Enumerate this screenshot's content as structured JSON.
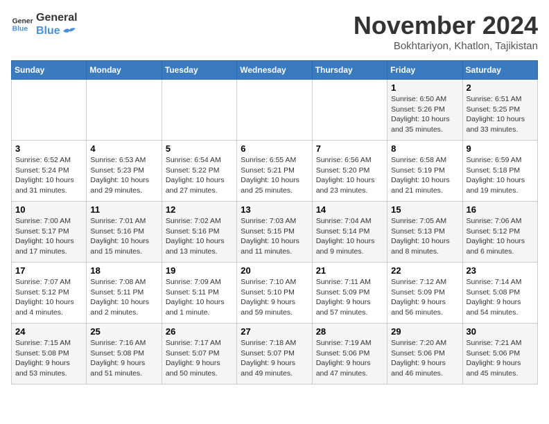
{
  "header": {
    "logo_line1": "General",
    "logo_line2": "Blue",
    "month": "November 2024",
    "location": "Bokhtariyon, Khatlon, Tajikistan"
  },
  "days_of_week": [
    "Sunday",
    "Monday",
    "Tuesday",
    "Wednesday",
    "Thursday",
    "Friday",
    "Saturday"
  ],
  "weeks": [
    [
      {
        "day": "",
        "info": ""
      },
      {
        "day": "",
        "info": ""
      },
      {
        "day": "",
        "info": ""
      },
      {
        "day": "",
        "info": ""
      },
      {
        "day": "",
        "info": ""
      },
      {
        "day": "1",
        "info": "Sunrise: 6:50 AM\nSunset: 5:26 PM\nDaylight: 10 hours\nand 35 minutes."
      },
      {
        "day": "2",
        "info": "Sunrise: 6:51 AM\nSunset: 5:25 PM\nDaylight: 10 hours\nand 33 minutes."
      }
    ],
    [
      {
        "day": "3",
        "info": "Sunrise: 6:52 AM\nSunset: 5:24 PM\nDaylight: 10 hours\nand 31 minutes."
      },
      {
        "day": "4",
        "info": "Sunrise: 6:53 AM\nSunset: 5:23 PM\nDaylight: 10 hours\nand 29 minutes."
      },
      {
        "day": "5",
        "info": "Sunrise: 6:54 AM\nSunset: 5:22 PM\nDaylight: 10 hours\nand 27 minutes."
      },
      {
        "day": "6",
        "info": "Sunrise: 6:55 AM\nSunset: 5:21 PM\nDaylight: 10 hours\nand 25 minutes."
      },
      {
        "day": "7",
        "info": "Sunrise: 6:56 AM\nSunset: 5:20 PM\nDaylight: 10 hours\nand 23 minutes."
      },
      {
        "day": "8",
        "info": "Sunrise: 6:58 AM\nSunset: 5:19 PM\nDaylight: 10 hours\nand 21 minutes."
      },
      {
        "day": "9",
        "info": "Sunrise: 6:59 AM\nSunset: 5:18 PM\nDaylight: 10 hours\nand 19 minutes."
      }
    ],
    [
      {
        "day": "10",
        "info": "Sunrise: 7:00 AM\nSunset: 5:17 PM\nDaylight: 10 hours\nand 17 minutes."
      },
      {
        "day": "11",
        "info": "Sunrise: 7:01 AM\nSunset: 5:16 PM\nDaylight: 10 hours\nand 15 minutes."
      },
      {
        "day": "12",
        "info": "Sunrise: 7:02 AM\nSunset: 5:16 PM\nDaylight: 10 hours\nand 13 minutes."
      },
      {
        "day": "13",
        "info": "Sunrise: 7:03 AM\nSunset: 5:15 PM\nDaylight: 10 hours\nand 11 minutes."
      },
      {
        "day": "14",
        "info": "Sunrise: 7:04 AM\nSunset: 5:14 PM\nDaylight: 10 hours\nand 9 minutes."
      },
      {
        "day": "15",
        "info": "Sunrise: 7:05 AM\nSunset: 5:13 PM\nDaylight: 10 hours\nand 8 minutes."
      },
      {
        "day": "16",
        "info": "Sunrise: 7:06 AM\nSunset: 5:12 PM\nDaylight: 10 hours\nand 6 minutes."
      }
    ],
    [
      {
        "day": "17",
        "info": "Sunrise: 7:07 AM\nSunset: 5:12 PM\nDaylight: 10 hours\nand 4 minutes."
      },
      {
        "day": "18",
        "info": "Sunrise: 7:08 AM\nSunset: 5:11 PM\nDaylight: 10 hours\nand 2 minutes."
      },
      {
        "day": "19",
        "info": "Sunrise: 7:09 AM\nSunset: 5:11 PM\nDaylight: 10 hours\nand 1 minute."
      },
      {
        "day": "20",
        "info": "Sunrise: 7:10 AM\nSunset: 5:10 PM\nDaylight: 9 hours\nand 59 minutes."
      },
      {
        "day": "21",
        "info": "Sunrise: 7:11 AM\nSunset: 5:09 PM\nDaylight: 9 hours\nand 57 minutes."
      },
      {
        "day": "22",
        "info": "Sunrise: 7:12 AM\nSunset: 5:09 PM\nDaylight: 9 hours\nand 56 minutes."
      },
      {
        "day": "23",
        "info": "Sunrise: 7:14 AM\nSunset: 5:08 PM\nDaylight: 9 hours\nand 54 minutes."
      }
    ],
    [
      {
        "day": "24",
        "info": "Sunrise: 7:15 AM\nSunset: 5:08 PM\nDaylight: 9 hours\nand 53 minutes."
      },
      {
        "day": "25",
        "info": "Sunrise: 7:16 AM\nSunset: 5:08 PM\nDaylight: 9 hours\nand 51 minutes."
      },
      {
        "day": "26",
        "info": "Sunrise: 7:17 AM\nSunset: 5:07 PM\nDaylight: 9 hours\nand 50 minutes."
      },
      {
        "day": "27",
        "info": "Sunrise: 7:18 AM\nSunset: 5:07 PM\nDaylight: 9 hours\nand 49 minutes."
      },
      {
        "day": "28",
        "info": "Sunrise: 7:19 AM\nSunset: 5:06 PM\nDaylight: 9 hours\nand 47 minutes."
      },
      {
        "day": "29",
        "info": "Sunrise: 7:20 AM\nSunset: 5:06 PM\nDaylight: 9 hours\nand 46 minutes."
      },
      {
        "day": "30",
        "info": "Sunrise: 7:21 AM\nSunset: 5:06 PM\nDaylight: 9 hours\nand 45 minutes."
      }
    ]
  ]
}
